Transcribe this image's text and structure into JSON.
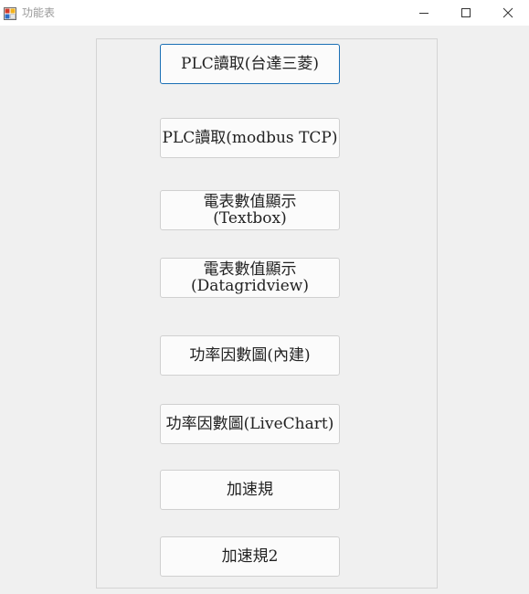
{
  "window": {
    "title": "功能表"
  },
  "buttons": [
    {
      "line1": "PLC讀取(台達三菱)",
      "line2": "",
      "focused": true
    },
    {
      "line1": "PLC讀取(modbus TCP)",
      "line2": ""
    },
    {
      "line1": "電表數值顯示",
      "line2": "(Textbox)"
    },
    {
      "line1": "電表數值顯示",
      "line2": "(Datagridview)"
    },
    {
      "line1": "功率因數圖(內建)",
      "line2": ""
    },
    {
      "line1": "功率因數圖(LiveChart)",
      "line2": ""
    },
    {
      "line1": "加速規",
      "line2": ""
    },
    {
      "line1": "加速規2",
      "line2": ""
    }
  ],
  "colors": {
    "focus_border": "#1a6fb5",
    "window_bg": "#f0f0f0"
  },
  "icons": {
    "app": "app-form-icon",
    "minimize": "minimize-icon",
    "maximize": "maximize-icon",
    "close": "close-icon"
  }
}
